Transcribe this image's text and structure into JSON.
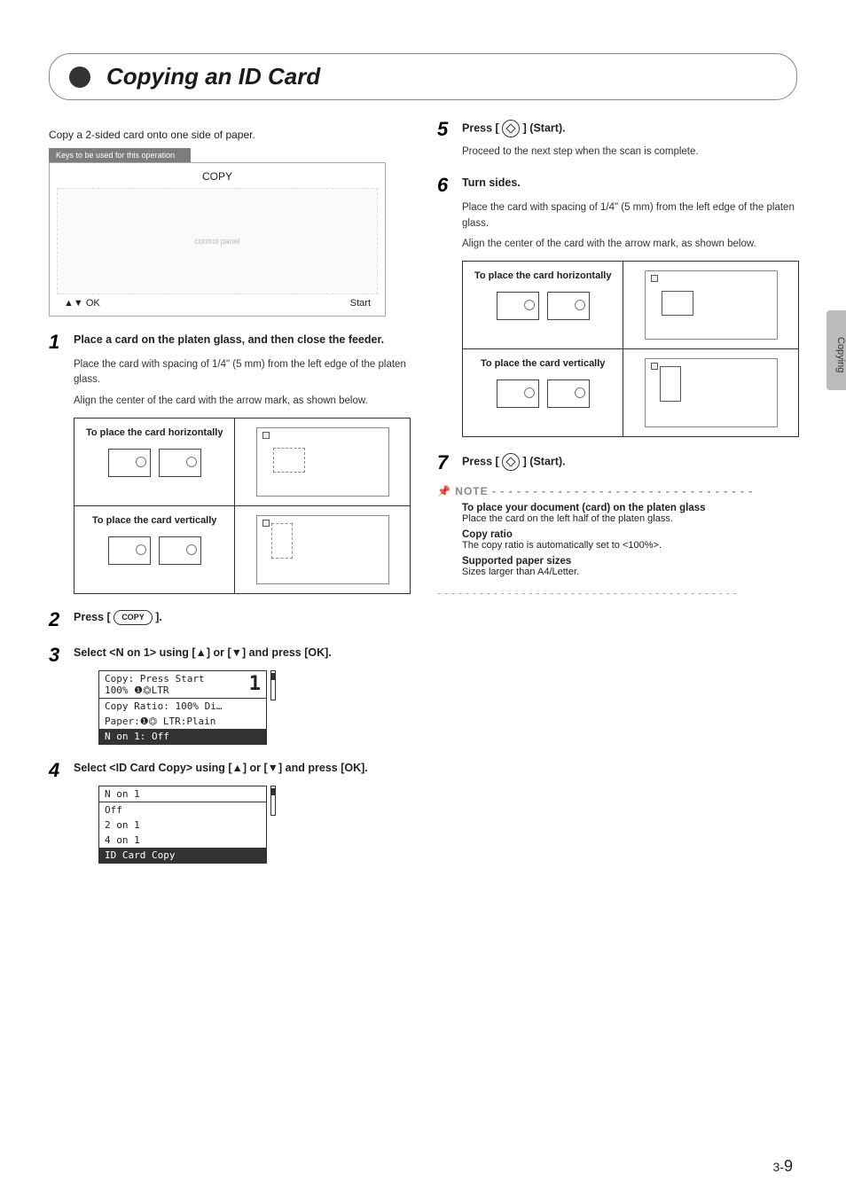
{
  "title": "Copying an ID Card",
  "intro": "Copy a 2-sided card onto one side of paper.",
  "keys_banner": "Keys to be used for this operation",
  "panel_label": "COPY",
  "panel_footer_left": "▲▼ OK",
  "panel_footer_right": "Start",
  "side_tab": "Copying",
  "page_number_section": "3-",
  "page_number": "9",
  "steps": {
    "s1": {
      "num": "1",
      "head": "Place a card on the platen glass, and then close the feeder.",
      "body1": "Place the card with spacing of 1/4\" (5 mm) from the left edge of the platen glass.",
      "body2": "Align the center of the card with the arrow mark, as shown below.",
      "row1": "To place the card horizontally",
      "row2": "To place the card vertically"
    },
    "s2": {
      "num": "2",
      "head_a": "Press [",
      "head_key": "COPY",
      "head_b": "]."
    },
    "s3": {
      "num": "3",
      "head": "Select <N on 1> using [▲] or [▼] and press [OK].",
      "menu": {
        "l1": "Copy: Press Start",
        "l2": " 100% ❶⏣LTR",
        "big": "1",
        "l3": " Copy Ratio: 100% Di…",
        "l4": " Paper:❶⏣ LTR:Plain",
        "l5": " N on 1: Off"
      }
    },
    "s4": {
      "num": "4",
      "head": "Select <ID Card Copy> using [▲] or [▼] and press [OK].",
      "menu": {
        "t": " N on 1",
        "o1": "  Off",
        "o2": "  2 on 1",
        "o3": "  4 on 1",
        "o4": "  ID Card Copy"
      }
    },
    "s5": {
      "num": "5",
      "head_a": "Press [",
      "head_b": "] (Start).",
      "body": "Proceed to the next step when the scan is complete."
    },
    "s6": {
      "num": "6",
      "head": "Turn sides.",
      "body1": "Place the card with spacing of 1/4\" (5 mm) from the left edge of the platen glass.",
      "body2": "Align the center of the card with the arrow mark, as shown below.",
      "row1": "To place the card horizontally",
      "row2": "To place the card vertically"
    },
    "s7": {
      "num": "7",
      "head_a": "Press [",
      "head_b": "] (Start)."
    }
  },
  "note": {
    "label": "NOTE",
    "h1": "To place your document (card) on the platen glass",
    "t1": "Place the card on the left half of the platen glass.",
    "h2": "Copy ratio",
    "t2": "The copy ratio is automatically set to <100%>.",
    "h3": "Supported paper sizes",
    "t3": "Sizes larger than A4/Letter."
  }
}
